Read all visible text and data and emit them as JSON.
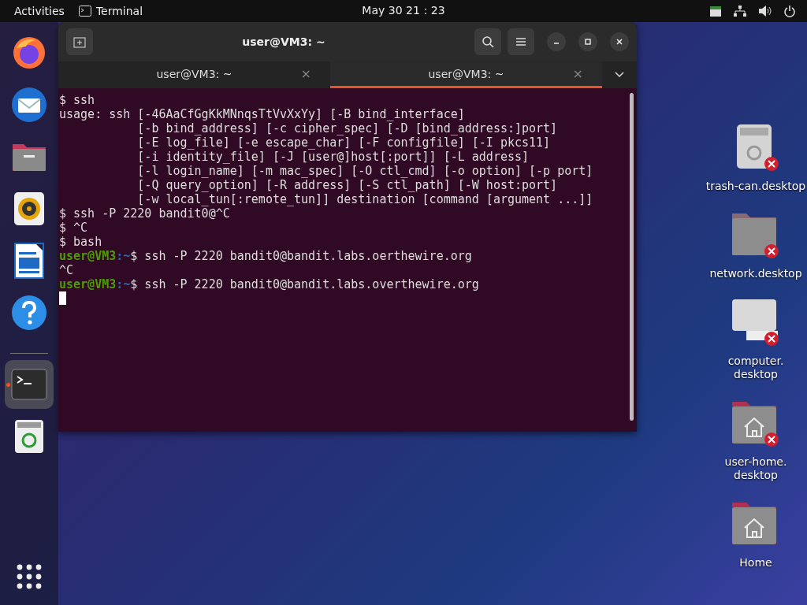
{
  "top_bar": {
    "activities": "Activities",
    "app_name": "Terminal",
    "clock": "May 30  21：23"
  },
  "dock": {
    "items": [
      {
        "kind": "browser",
        "active": false
      },
      {
        "kind": "mail",
        "active": false
      },
      {
        "kind": "files",
        "active": false
      },
      {
        "kind": "music",
        "active": false
      },
      {
        "kind": "writer",
        "active": false
      },
      {
        "kind": "help",
        "active": false
      },
      {
        "kind": "separator"
      },
      {
        "kind": "terminal",
        "active": true
      },
      {
        "kind": "trash",
        "active": false
      }
    ]
  },
  "terminal": {
    "title": "user@VM3: ~",
    "tabs": [
      {
        "label": "user@VM3: ~",
        "close": "×",
        "selected": false
      },
      {
        "label": "user@VM3: ~",
        "close": "×",
        "selected": true
      }
    ],
    "lines": [
      {
        "kind": "output",
        "text": "$ ssh"
      },
      {
        "kind": "output",
        "text": "usage: ssh [-46AaCfGgKkMNnqsTtVvXxYy] [-B bind_interface]"
      },
      {
        "kind": "output",
        "text": "           [-b bind_address] [-c cipher_spec] [-D [bind_address:]port]"
      },
      {
        "kind": "output",
        "text": "           [-E log_file] [-e escape_char] [-F configfile] [-I pkcs11]"
      },
      {
        "kind": "output",
        "text": "           [-i identity_file] [-J [user@]host[:port]] [-L address]"
      },
      {
        "kind": "output",
        "text": "           [-l login_name] [-m mac_spec] [-O ctl_cmd] [-o option] [-p port]"
      },
      {
        "kind": "output",
        "text": "           [-Q query_option] [-R address] [-S ctl_path] [-W host:port]"
      },
      {
        "kind": "output",
        "text": "           [-w local_tun[:remote_tun]] destination [command [argument ...]]"
      },
      {
        "kind": "output",
        "text": "$ ssh -P 2220 bandit0@^C"
      },
      {
        "kind": "output",
        "text": "$ ^C"
      },
      {
        "kind": "output",
        "text": "$ bash"
      },
      {
        "kind": "prompt",
        "user": "user@VM3",
        "path": ":~",
        "text": "$ ssh -P 2220 bandit0@bandit.labs.oerthewire.org"
      },
      {
        "kind": "output",
        "text": "^C"
      },
      {
        "kind": "prompt",
        "user": "user@VM3",
        "path": ":~",
        "text": "$ ssh -P 2220 bandit0@bandit.labs.overthewire.org"
      },
      {
        "kind": "cursor"
      }
    ]
  },
  "desktop_icons": [
    {
      "kind": "trash",
      "broken": true,
      "label_lines": [
        "trash-can.desktop"
      ]
    },
    {
      "kind": "folder",
      "broken": true,
      "label_lines": [
        "network.desktop"
      ]
    },
    {
      "kind": "computer",
      "broken": true,
      "label_lines": [
        "computer.",
        "desktop"
      ]
    },
    {
      "kind": "home-folder",
      "broken": true,
      "label_lines": [
        "user-home.",
        "desktop"
      ]
    },
    {
      "kind": "home-folder",
      "broken": false,
      "label_lines": [
        "Home"
      ]
    }
  ]
}
